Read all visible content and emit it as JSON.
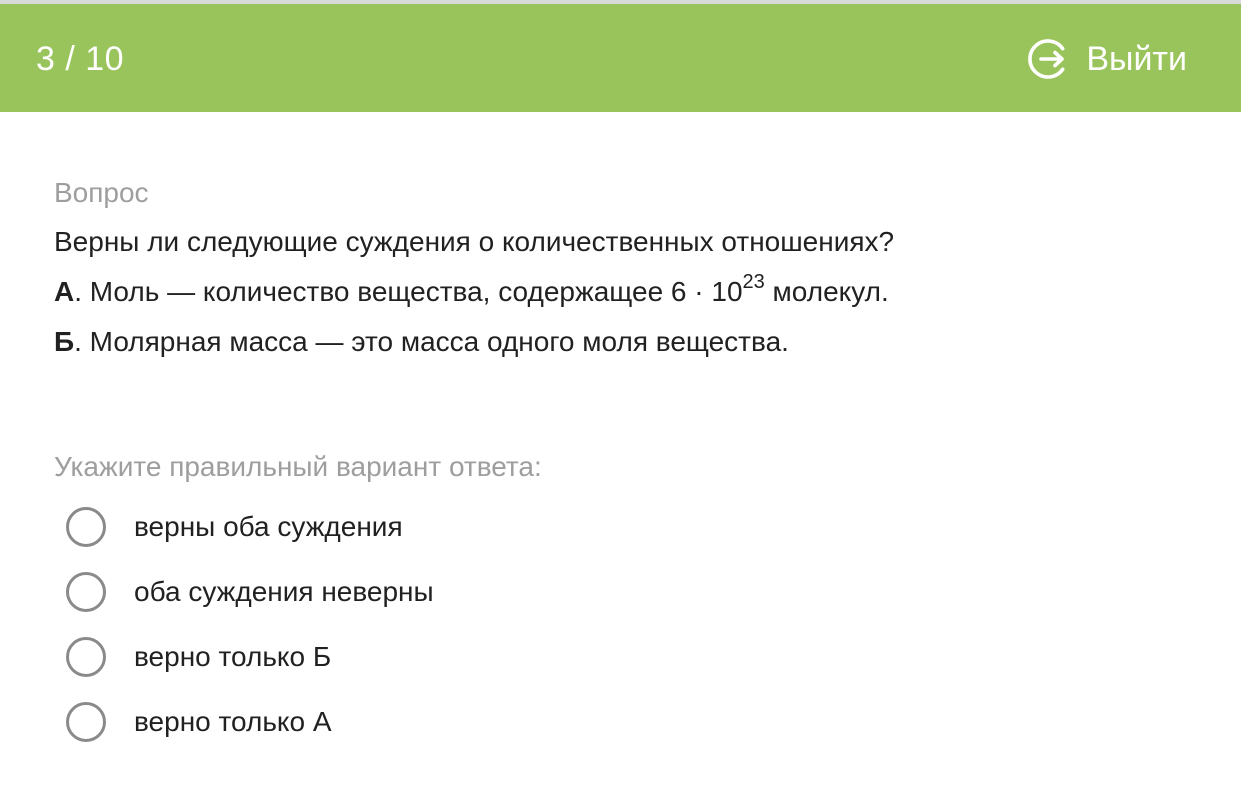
{
  "header": {
    "progress": "3 / 10",
    "exit_label": "Выйти",
    "background": "#99c45c",
    "exit_icon": "exit-icon"
  },
  "question": {
    "caption": "Вопрос",
    "title": "Верны ли следующие суждения о количественных отношениях?",
    "statements": [
      {
        "letter": "А",
        "text_before": ". Моль — количество вещества, содержащее 6 · 10",
        "superscript": "23",
        "text_after": " молекул."
      },
      {
        "letter": "Б",
        "text_before": ". Молярная масса — это масса одного моля вещества.",
        "superscript": "",
        "text_after": ""
      }
    ]
  },
  "answer": {
    "caption": "Укажите правильный вариант ответа:",
    "options": [
      {
        "label": "верны оба суждения",
        "selected": false
      },
      {
        "label": "оба суждения неверны",
        "selected": false
      },
      {
        "label": "верно только Б",
        "selected": false
      },
      {
        "label": "верно только А",
        "selected": false
      }
    ]
  }
}
